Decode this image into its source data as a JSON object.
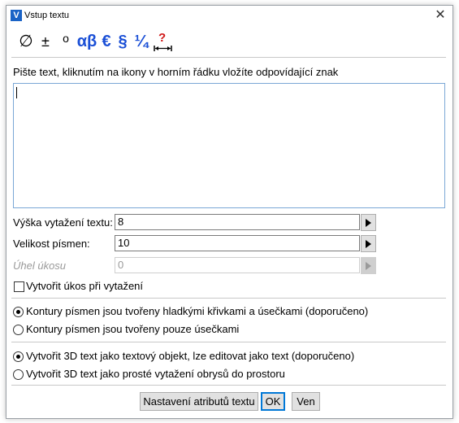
{
  "window": {
    "title": "Vstup textu",
    "app_icon_glyph": "V"
  },
  "toolbar": {
    "items": [
      {
        "glyph": "∅",
        "name": "diameter-symbol-icon",
        "color": "#000000"
      },
      {
        "glyph": "±",
        "name": "plus-minus-symbol-icon",
        "color": "#000000"
      },
      {
        "glyph": "o",
        "name": "degree-symbol-icon",
        "color": "#000000"
      },
      {
        "glyph": "αβ",
        "name": "greek-letters-icon",
        "color": "#1a4fd6"
      },
      {
        "glyph": "€",
        "name": "currency-symbols-icon",
        "color": "#1a4fd6"
      },
      {
        "glyph": "§",
        "name": "section-symbol-icon",
        "color": "#1a4fd6"
      },
      {
        "glyph": "¼",
        "name": "fraction-symbol-icon",
        "color": "#1a4fd6"
      },
      {
        "glyph": "?",
        "name": "help-width-icon",
        "color": "#d01818"
      }
    ]
  },
  "instruction": "Pište text, kliknutím na ikony v horním řádku vložíte odpovídající znak",
  "text_value": "",
  "fields": {
    "extrusion_height": {
      "label": "Výška vytažení textu:",
      "value": "8"
    },
    "font_size": {
      "label": "Velikost písmen:",
      "value": "10"
    },
    "slant_angle": {
      "label": "Úhel úkosu",
      "value": "0"
    }
  },
  "checkbox": {
    "label": "Vytvořit úkos při vytažení",
    "checked": false
  },
  "contour_options": [
    {
      "label": "Kontury písmen jsou tvořeny hladkými křivkami a úsečkami (doporučeno)",
      "selected": true
    },
    {
      "label": "Kontury písmen jsou tvořeny pouze úsečkami",
      "selected": false
    }
  ],
  "object_options": [
    {
      "label": "Vytvořit 3D text jako textový objekt, lze editovat jako text (doporučeno)",
      "selected": true
    },
    {
      "label": "Vytvořit 3D text jako prosté vytažení obrysů do prostoru",
      "selected": false
    }
  ],
  "buttons": {
    "attributes": "Nastavení atributů textu",
    "ok": "OK",
    "cancel": "Ven"
  }
}
